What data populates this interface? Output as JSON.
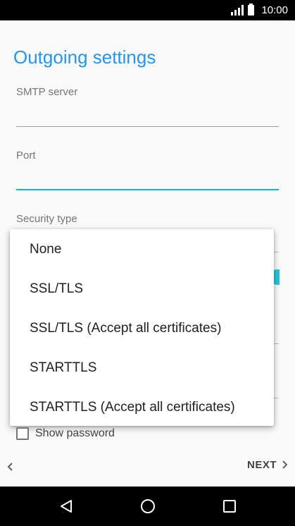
{
  "status_bar": {
    "time": "10:00"
  },
  "page": {
    "title": "Outgoing settings"
  },
  "fields": {
    "smtp_server_label": "SMTP server",
    "port_label": "Port",
    "security_type_label": "Security type"
  },
  "dropdown": {
    "options": [
      "None",
      "SSL/TLS",
      "SSL/TLS (Accept all certificates)",
      "STARTTLS",
      "STARTTLS (Accept all certificates)"
    ]
  },
  "show_password": {
    "label": "Show password",
    "checked": false
  },
  "footer": {
    "next_label": "NEXT"
  },
  "colors": {
    "accent": "#2196f3",
    "active_underline": "#00bcd4"
  },
  "icons": [
    "signal-icon",
    "battery-icon",
    "chevron-left-icon",
    "chevron-right-icon",
    "nav-back-icon",
    "nav-home-icon",
    "nav-recents-icon"
  ]
}
